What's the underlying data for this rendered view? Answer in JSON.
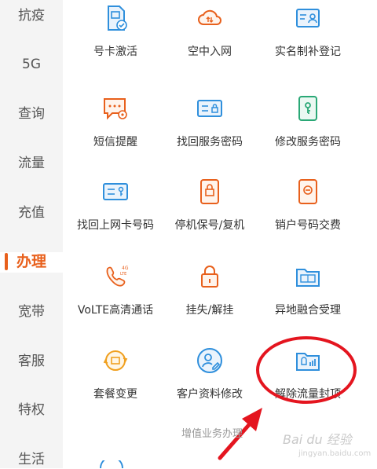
{
  "sidebar": {
    "items": [
      "抗疫",
      "5G",
      "查询",
      "流量",
      "充值",
      "办理",
      "宽带",
      "客服",
      "特权",
      "生活"
    ],
    "active": "办理"
  },
  "grid": {
    "items": [
      {
        "label": "号卡激活",
        "icon": "sim-card-icon"
      },
      {
        "label": "空中入网",
        "icon": "cloud-icon"
      },
      {
        "label": "实名制补登记",
        "icon": "id-card-icon"
      },
      {
        "label": "短信提醒",
        "icon": "sms-gear-icon"
      },
      {
        "label": "找回服务密码",
        "icon": "password-card-icon"
      },
      {
        "label": "修改服务密码",
        "icon": "key-phone-icon"
      },
      {
        "label": "找回上网卡号码",
        "icon": "card-key-icon"
      },
      {
        "label": "停机保号/复机",
        "icon": "phone-lock-icon"
      },
      {
        "label": "销户号码交费",
        "icon": "phone-cancel-icon"
      },
      {
        "label": "VoLTE高清通话",
        "icon": "volte-phone-icon"
      },
      {
        "label": "挂失/解挂",
        "icon": "padlock-icon"
      },
      {
        "label": "异地融合受理",
        "icon": "merge-folder-icon"
      },
      {
        "label": "套餐变更",
        "icon": "package-change-icon"
      },
      {
        "label": "客户资料修改",
        "icon": "user-edit-icon"
      },
      {
        "label": "解除流量封顶",
        "icon": "data-cap-icon"
      }
    ]
  },
  "section": {
    "label": "增值业务办理"
  },
  "watermark": {
    "text": "Bai du 经验",
    "url": "jingyan.baidu.com"
  },
  "colors": {
    "accent_orange": "#e8601c",
    "accent_blue": "#2f8fdc",
    "highlight_red": "#e4151f"
  }
}
